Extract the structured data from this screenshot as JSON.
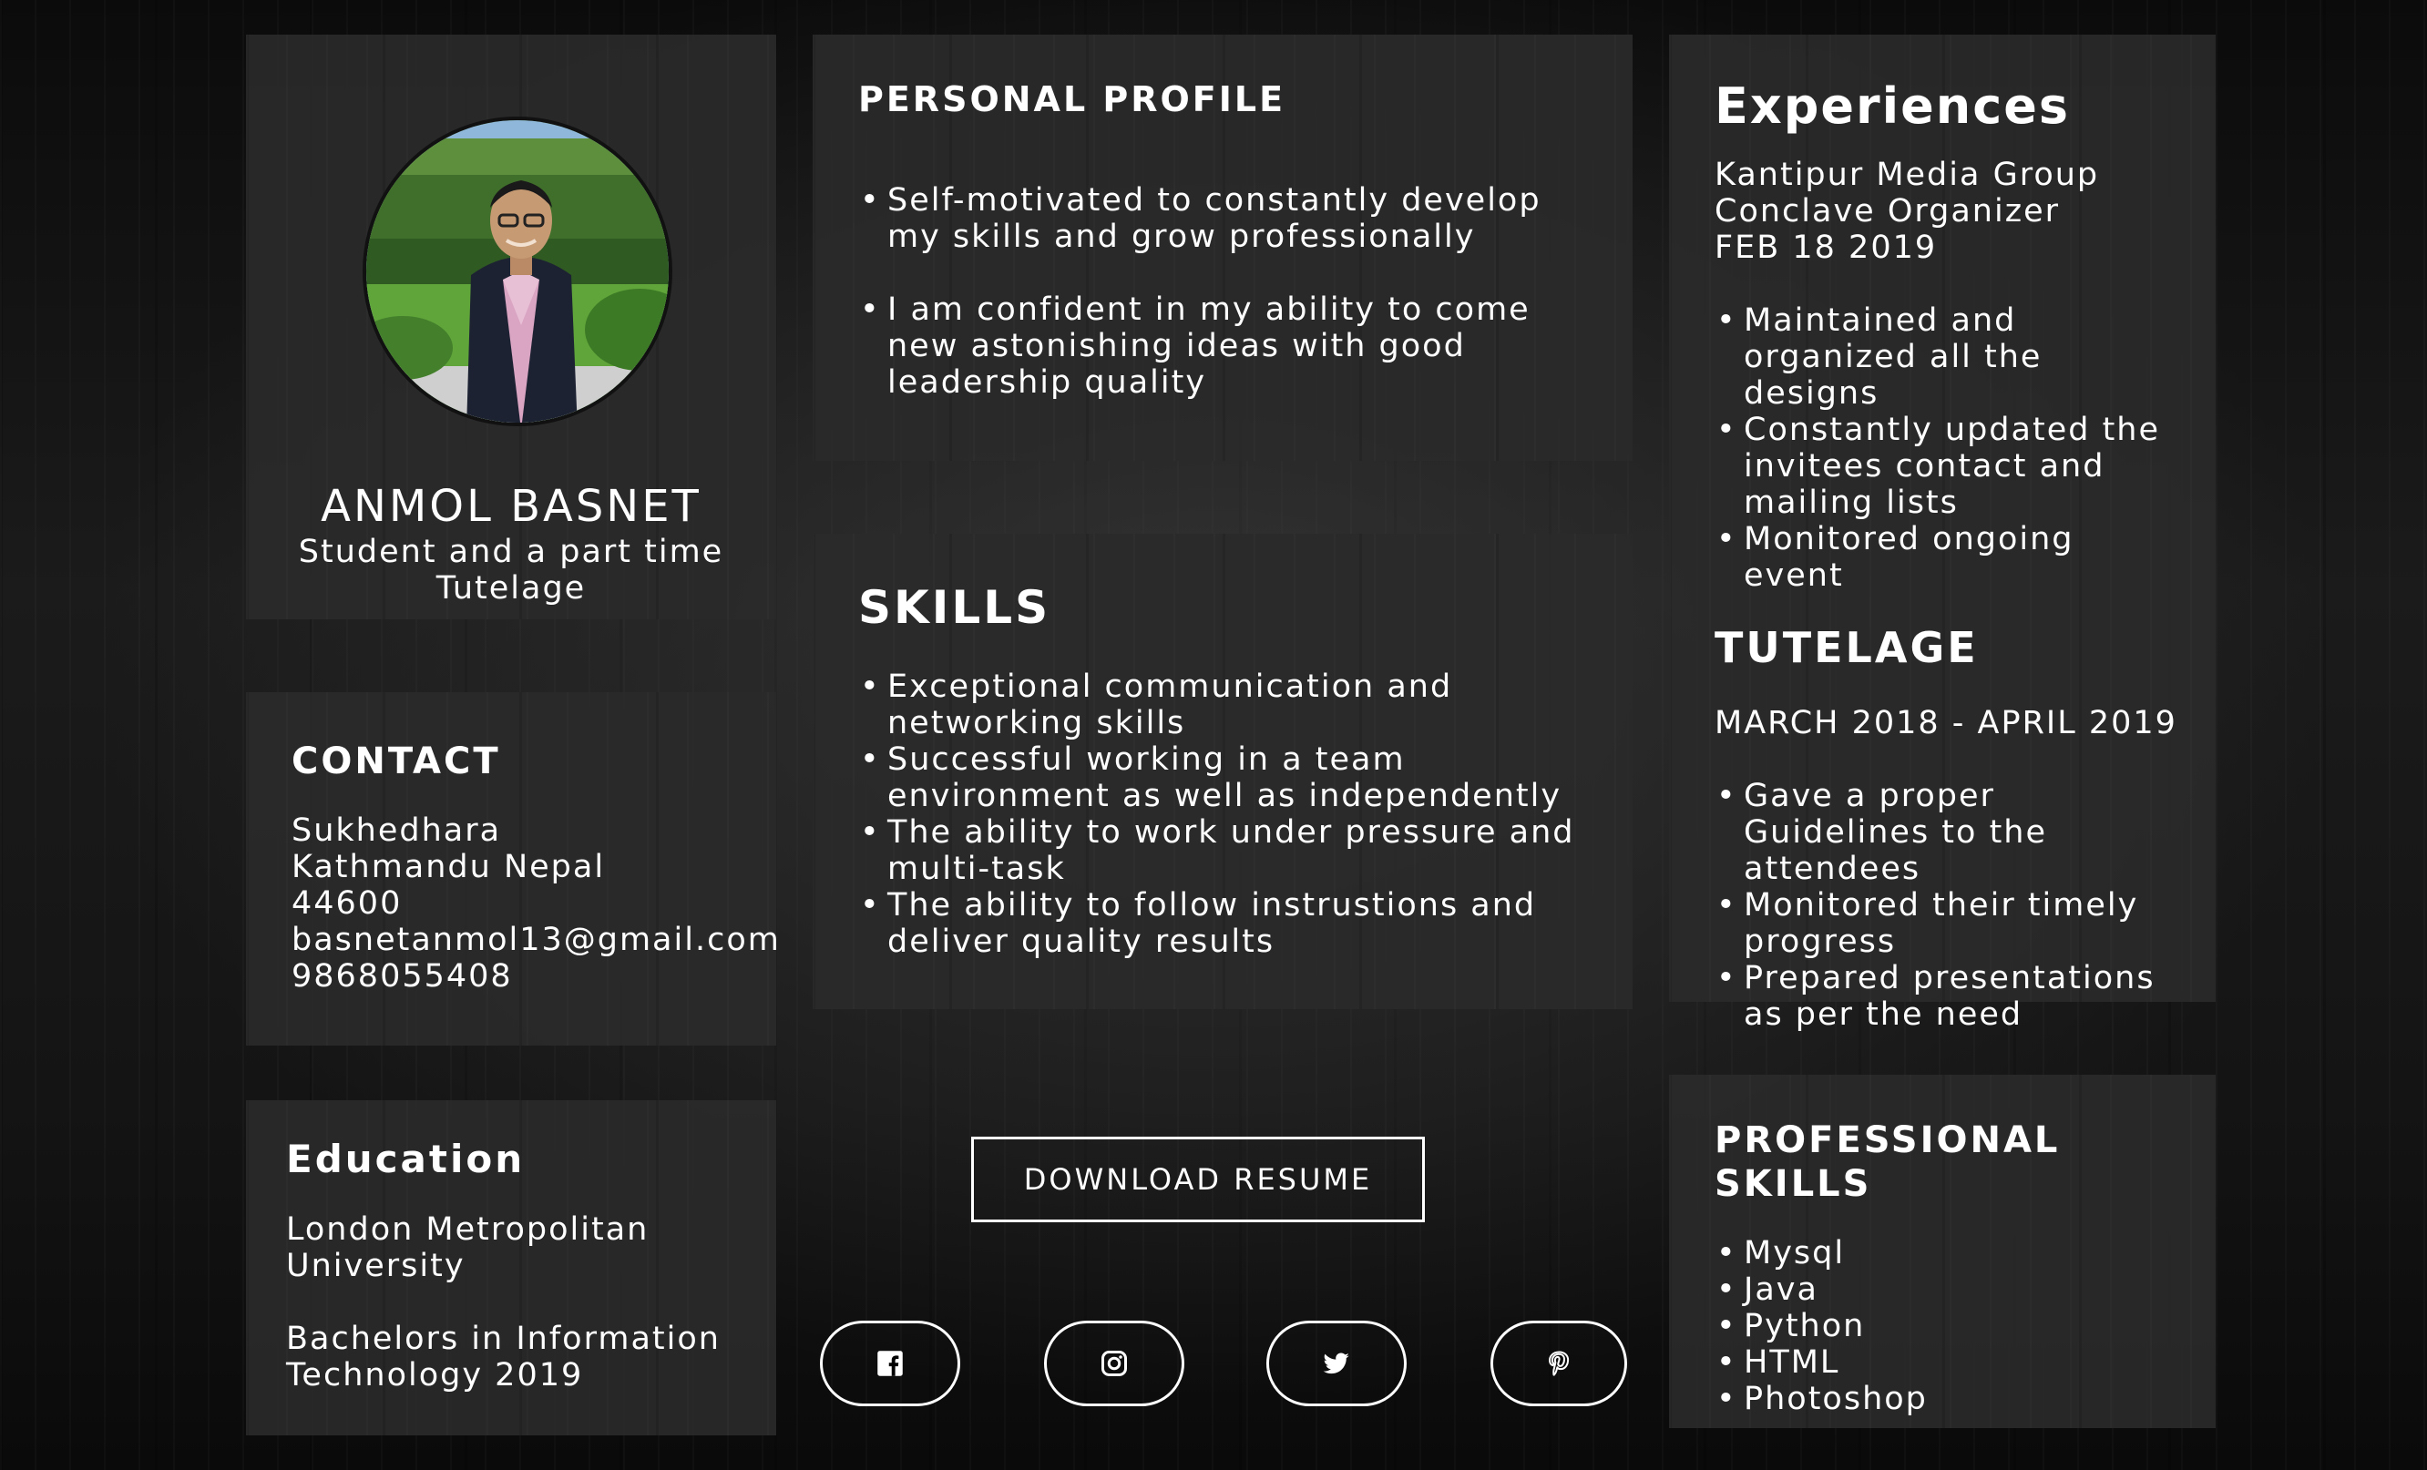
{
  "profile": {
    "name": "ANMOL BASNET",
    "role_line1": "Student and a part time",
    "role_line2": "Tutelage"
  },
  "contact": {
    "heading": "CONTACT",
    "lines": [
      "Sukhedhara",
      "Kathmandu Nepal",
      "44600",
      "basnetanmol13@gmail.com",
      "9868055408"
    ]
  },
  "education": {
    "heading": "Education",
    "university_line1": "London Metropolitan",
    "university_line2": "University",
    "degree_line1": "Bachelors in Information",
    "degree_line2": "Technology 2019"
  },
  "personal_profile": {
    "heading": "PERSONAL PROFILE",
    "items": [
      "Self-motivated to constantly develop my skills and grow professionally",
      "I am confident in my ability to come new astonishing ideas with good leadership quality"
    ]
  },
  "skills": {
    "heading": "SKILLS",
    "items": [
      "Exceptional communication and networking skills",
      "Successful working in a team environment as well as independently",
      "The ability to work under pressure and multi-task",
      "The ability to follow instrustions and deliver quality results"
    ]
  },
  "experiences": {
    "heading": "Experiences",
    "company": "Kantipur Media Group",
    "position": "Conclave Organizer",
    "date": "FEB 18 2019",
    "items": [
      "Maintained and organized all the designs",
      "Constantly updated the invitees contact and mailing lists",
      "Monitored ongoing event"
    ],
    "tutelage_heading": "TUTELAGE",
    "tutelage_date": "MARCH 2018 - APRIL 2019",
    "tutelage_items": [
      "Gave a proper Guidelines to the attendees",
      "Monitored their timely   progress",
      "Prepared presentations as per the need"
    ]
  },
  "professional_skills": {
    "heading": "PROFESSIONAL SKILLS",
    "items": [
      "Mysql",
      "Java",
      "Python",
      "HTML",
      "Photoshop"
    ]
  },
  "download_label": "DOWNLOAD RESUME",
  "social_icons": [
    "facebook-icon",
    "instagram-icon",
    "twitter-icon",
    "pinterest-icon"
  ],
  "colors": {
    "text": "#ffffff",
    "card": "#2a2a2a",
    "background": "#141414"
  }
}
